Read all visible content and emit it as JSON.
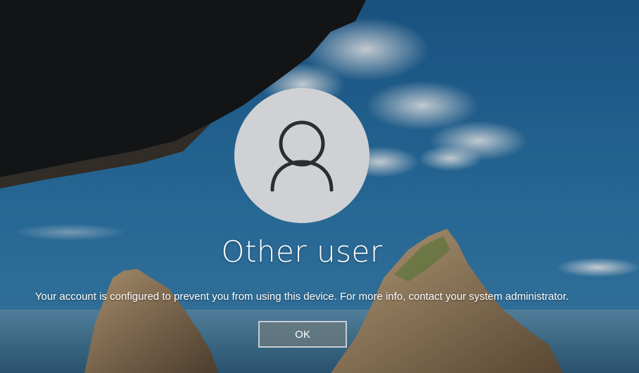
{
  "user": {
    "name": "Other user",
    "avatar_icon": "user-silhouette-icon"
  },
  "message": "Your account is configured to prevent you from using this device. For more info, contact your system administrator.",
  "ok_button": {
    "label": "OK"
  },
  "colors": {
    "avatar_background": "#cfd1d4",
    "avatar_glyph": "#2b2d30",
    "text": "#ffffff",
    "button_border": "#c8cdd3"
  }
}
